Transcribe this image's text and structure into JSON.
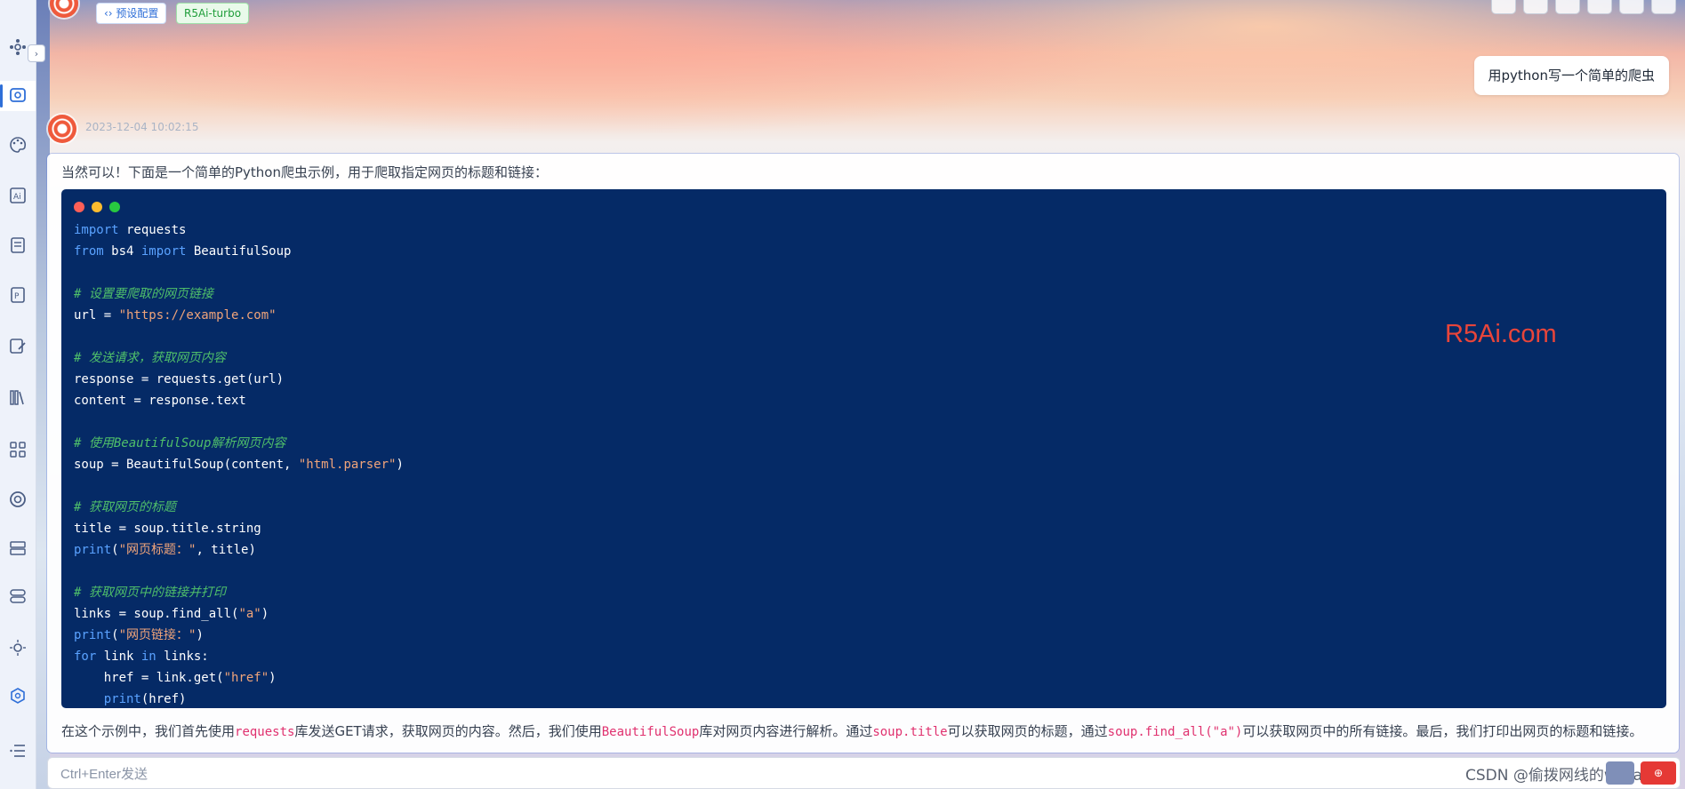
{
  "header": {
    "preset_label": "‹› 预设配置",
    "model_label": "R5Ai-turbo"
  },
  "sidebar": {
    "items": [
      {
        "icon": "plugin-icon"
      },
      {
        "icon": "chat-icon",
        "active": true
      },
      {
        "icon": "palette-icon"
      },
      {
        "icon": "ai-icon"
      },
      {
        "icon": "document-icon"
      },
      {
        "icon": "ppt-icon"
      },
      {
        "icon": "edit-icon"
      },
      {
        "icon": "library-icon"
      },
      {
        "icon": "apps-icon"
      },
      {
        "icon": "openai-icon"
      },
      {
        "icon": "server-icon"
      },
      {
        "icon": "toggle-icon"
      },
      {
        "icon": "sun-icon"
      },
      {
        "icon": "hexagon-icon"
      },
      {
        "icon": "menu-icon"
      }
    ]
  },
  "user_message": "用python写一个简单的爬虫",
  "assistant": {
    "timestamp": "2023-12-04 10:02:15",
    "intro": "当然可以！下面是一个简单的Python爬虫示例，用于爬取指定网页的标题和链接：",
    "code": [
      [
        {
          "t": "import",
          "c": "kw"
        },
        {
          "t": " requests",
          "c": "tx"
        }
      ],
      [
        {
          "t": "from",
          "c": "kw"
        },
        {
          "t": " bs4 ",
          "c": "tx"
        },
        {
          "t": "import",
          "c": "kw"
        },
        {
          "t": " BeautifulSoup",
          "c": "tx"
        }
      ],
      [],
      [
        {
          "t": "# 设置要爬取的网页链接",
          "c": "cm"
        }
      ],
      [
        {
          "t": "url = ",
          "c": "tx"
        },
        {
          "t": "\"https://example.com\"",
          "c": "st"
        }
      ],
      [],
      [
        {
          "t": "# 发送请求，获取网页内容",
          "c": "cm"
        }
      ],
      [
        {
          "t": "response = requests.get(url)",
          "c": "tx"
        }
      ],
      [
        {
          "t": "content = response.text",
          "c": "tx"
        }
      ],
      [],
      [
        {
          "t": "# 使用BeautifulSoup解析网页内容",
          "c": "cm"
        }
      ],
      [
        {
          "t": "soup = BeautifulSoup(content, ",
          "c": "tx"
        },
        {
          "t": "\"html.parser\"",
          "c": "st"
        },
        {
          "t": ")",
          "c": "tx"
        }
      ],
      [],
      [
        {
          "t": "# 获取网页的标题",
          "c": "cm"
        }
      ],
      [
        {
          "t": "title = soup.title.string",
          "c": "tx"
        }
      ],
      [
        {
          "t": "print",
          "c": "kw"
        },
        {
          "t": "(",
          "c": "tx"
        },
        {
          "t": "\"网页标题：\"",
          "c": "st"
        },
        {
          "t": ", title)",
          "c": "tx"
        }
      ],
      [],
      [
        {
          "t": "# 获取网页中的链接并打印",
          "c": "cm"
        }
      ],
      [
        {
          "t": "links = soup.find_all(",
          "c": "tx"
        },
        {
          "t": "\"a\"",
          "c": "st"
        },
        {
          "t": ")",
          "c": "tx"
        }
      ],
      [
        {
          "t": "print",
          "c": "kw"
        },
        {
          "t": "(",
          "c": "tx"
        },
        {
          "t": "\"网页链接：\"",
          "c": "st"
        },
        {
          "t": ")",
          "c": "tx"
        }
      ],
      [
        {
          "t": "for",
          "c": "kw"
        },
        {
          "t": " link ",
          "c": "tx"
        },
        {
          "t": "in",
          "c": "kw"
        },
        {
          "t": " links:",
          "c": "tx"
        }
      ],
      [
        {
          "t": "    href = link.get(",
          "c": "tx"
        },
        {
          "t": "\"href\"",
          "c": "st"
        },
        {
          "t": ")",
          "c": "tx"
        }
      ],
      [
        {
          "t": "    ",
          "c": "tx"
        },
        {
          "t": "print",
          "c": "kw"
        },
        {
          "t": "(href)",
          "c": "tx"
        }
      ]
    ],
    "outro": [
      {
        "t": "在这个示例中，我们首先使用",
        "hl": false
      },
      {
        "t": "requests",
        "hl": true
      },
      {
        "t": "库发送GET请求，获取网页的内容。然后，我们使用",
        "hl": false
      },
      {
        "t": "BeautifulSoup",
        "hl": true
      },
      {
        "t": "库对网页内容进行解析。通过",
        "hl": false
      },
      {
        "t": "soup.title",
        "hl": true
      },
      {
        "t": "可以获取网页的标题，通过",
        "hl": false
      },
      {
        "t": "soup.find_all(\"a\")",
        "hl": true
      },
      {
        "t": "可以获取网页中的所有链接。最后，我们打印出网页的标题和链接。",
        "hl": false
      }
    ]
  },
  "watermark": "R5Ai.com",
  "input": {
    "placeholder": "Ctrl+Enter发送",
    "send_label": "⊕"
  },
  "csdn_watermark": "CSDN @偷拨网线的william",
  "colors": {
    "code_bg": "#052a66",
    "keyword": "#5aa2ff",
    "comment": "#4fbf6a",
    "string": "#f0a47a",
    "highlight": "#e0316f",
    "accent": "#2f6fd8",
    "watermark": "#e8453a"
  }
}
